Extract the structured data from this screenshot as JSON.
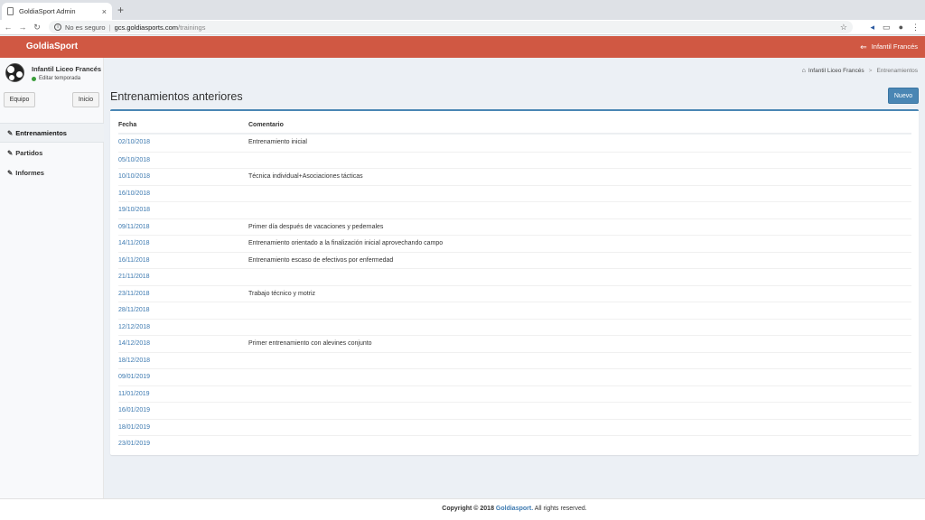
{
  "browser": {
    "tab_title": "GoldiaSport Admin",
    "tab_close": "×",
    "new_tab": "+",
    "security": "No es seguro",
    "separator": "|",
    "url_host": "gcs.goldiasports.com",
    "url_path": "/trainings"
  },
  "header": {
    "brand": "GoldiaSport",
    "user_name": "Infantil Francés"
  },
  "sidebar": {
    "team_name": "Infantil Liceo Francés",
    "season_link": "Editar temporada",
    "team_button": "Equipo",
    "home_button": "Inicio",
    "items": [
      {
        "label": "Entrenamientos",
        "active": true
      },
      {
        "label": "Partidos",
        "active": false
      },
      {
        "label": "Informes",
        "active": false
      }
    ]
  },
  "breadcrumb": {
    "home": "Infantil Liceo Francés",
    "separator": ">",
    "current": "Entrenamientos"
  },
  "main": {
    "title": "Entrenamientos anteriores",
    "new_button": "Nuevo",
    "columns": {
      "date": "Fecha",
      "comment": "Comentario"
    },
    "rows": [
      {
        "date": "02/10/2018",
        "comment": "Entrenamiento inicial"
      },
      {
        "date": "05/10/2018",
        "comment": ""
      },
      {
        "date": "10/10/2018",
        "comment": "Técnica individual+Asociaciones tácticas"
      },
      {
        "date": "16/10/2018",
        "comment": ""
      },
      {
        "date": "19/10/2018",
        "comment": ""
      },
      {
        "date": "09/11/2018",
        "comment": "Primer día después de vacaciones y pedernales"
      },
      {
        "date": "14/11/2018",
        "comment": "Entrenamiento orientado a la finalización inicial aprovechando campo"
      },
      {
        "date": "16/11/2018",
        "comment": "Entrenamiento escaso de efectivos por enfermedad"
      },
      {
        "date": "21/11/2018",
        "comment": ""
      },
      {
        "date": "23/11/2018",
        "comment": "Trabajo técnico y motriz"
      },
      {
        "date": "28/11/2018",
        "comment": ""
      },
      {
        "date": "12/12/2018",
        "comment": ""
      },
      {
        "date": "14/12/2018",
        "comment": "Primer entrenamiento con alevines conjunto"
      },
      {
        "date": "18/12/2018",
        "comment": ""
      },
      {
        "date": "09/01/2019",
        "comment": ""
      },
      {
        "date": "11/01/2019",
        "comment": ""
      },
      {
        "date": "16/01/2019",
        "comment": ""
      },
      {
        "date": "18/01/2019",
        "comment": ""
      },
      {
        "date": "23/01/2019",
        "comment": ""
      }
    ]
  },
  "footer": {
    "copyright": "Copyright © 2018",
    "brand": "Goldiasport.",
    "rights": "All rights reserved."
  }
}
